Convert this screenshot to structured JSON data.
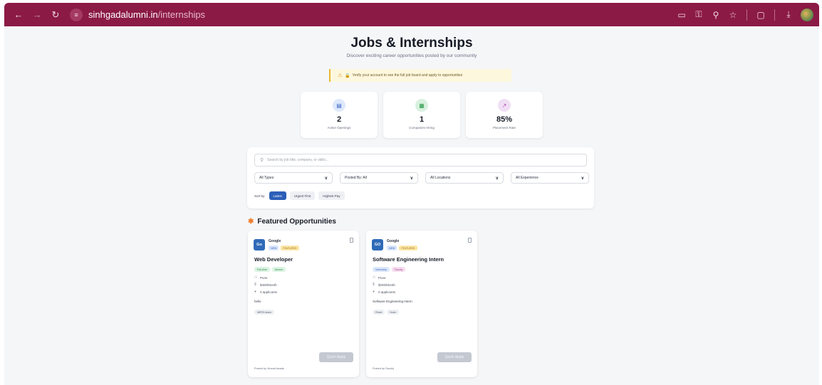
{
  "browser": {
    "url_host": "sinhgadalumni.in",
    "url_path": "/internships"
  },
  "page": {
    "title": "Jobs & Internships",
    "subtitle": "Discover exciting career opportunities posted by our community",
    "notice": "Verify your account to see the full job board and apply to opportunities"
  },
  "stats": [
    {
      "value": "2",
      "label": "Active Openings",
      "icon": "briefcase-icon"
    },
    {
      "value": "1",
      "label": "Companies Hiring",
      "icon": "building-icon"
    },
    {
      "value": "85%",
      "label": "Placement Rate",
      "icon": "trend-up-icon"
    }
  ],
  "filters": {
    "search_placeholder": "Search by job title, company, or skills...",
    "type": "All Types",
    "posted_by": "Posted By: All",
    "location": "All Locations",
    "experience": "All Experience",
    "sort_label": "Sort by:",
    "sort_options": [
      "Latest",
      "Urgent First",
      "Highest Pay"
    ],
    "sort_active": "Latest"
  },
  "featured_title": "Featured Opportunities",
  "jobs": [
    {
      "logo": "Go",
      "company": "Google",
      "badges": [
        "NEW",
        "FEATURED"
      ],
      "title": "Web Developer",
      "tags": [
        "Full-time",
        "Alumni"
      ],
      "location": "Pune",
      "salary": "$400/Month",
      "applicants": "0 applicants",
      "description": "hello",
      "skills": [
        "MERN stack"
      ],
      "apply_label": "Quick Apply",
      "posted_by": "Posted by Viranal Awade"
    },
    {
      "logo": "GO",
      "company": "Google",
      "badges": [
        "NEW",
        "FEATURED"
      ],
      "title": "Software Engineering Intern",
      "tags": [
        "Internship",
        "Faculty"
      ],
      "location": "Pune",
      "salary": "$200/Month",
      "applicants": "0 applicants",
      "description": "Software Engineering Intern",
      "skills": [
        "React",
        "Node"
      ],
      "apply_label": "Quick Apply",
      "posted_by": "Posted by Faculty"
    }
  ],
  "colors": {
    "chrome": "#8b1a45",
    "accent": "#2c5fb8",
    "notice_border": "#e9b730"
  }
}
